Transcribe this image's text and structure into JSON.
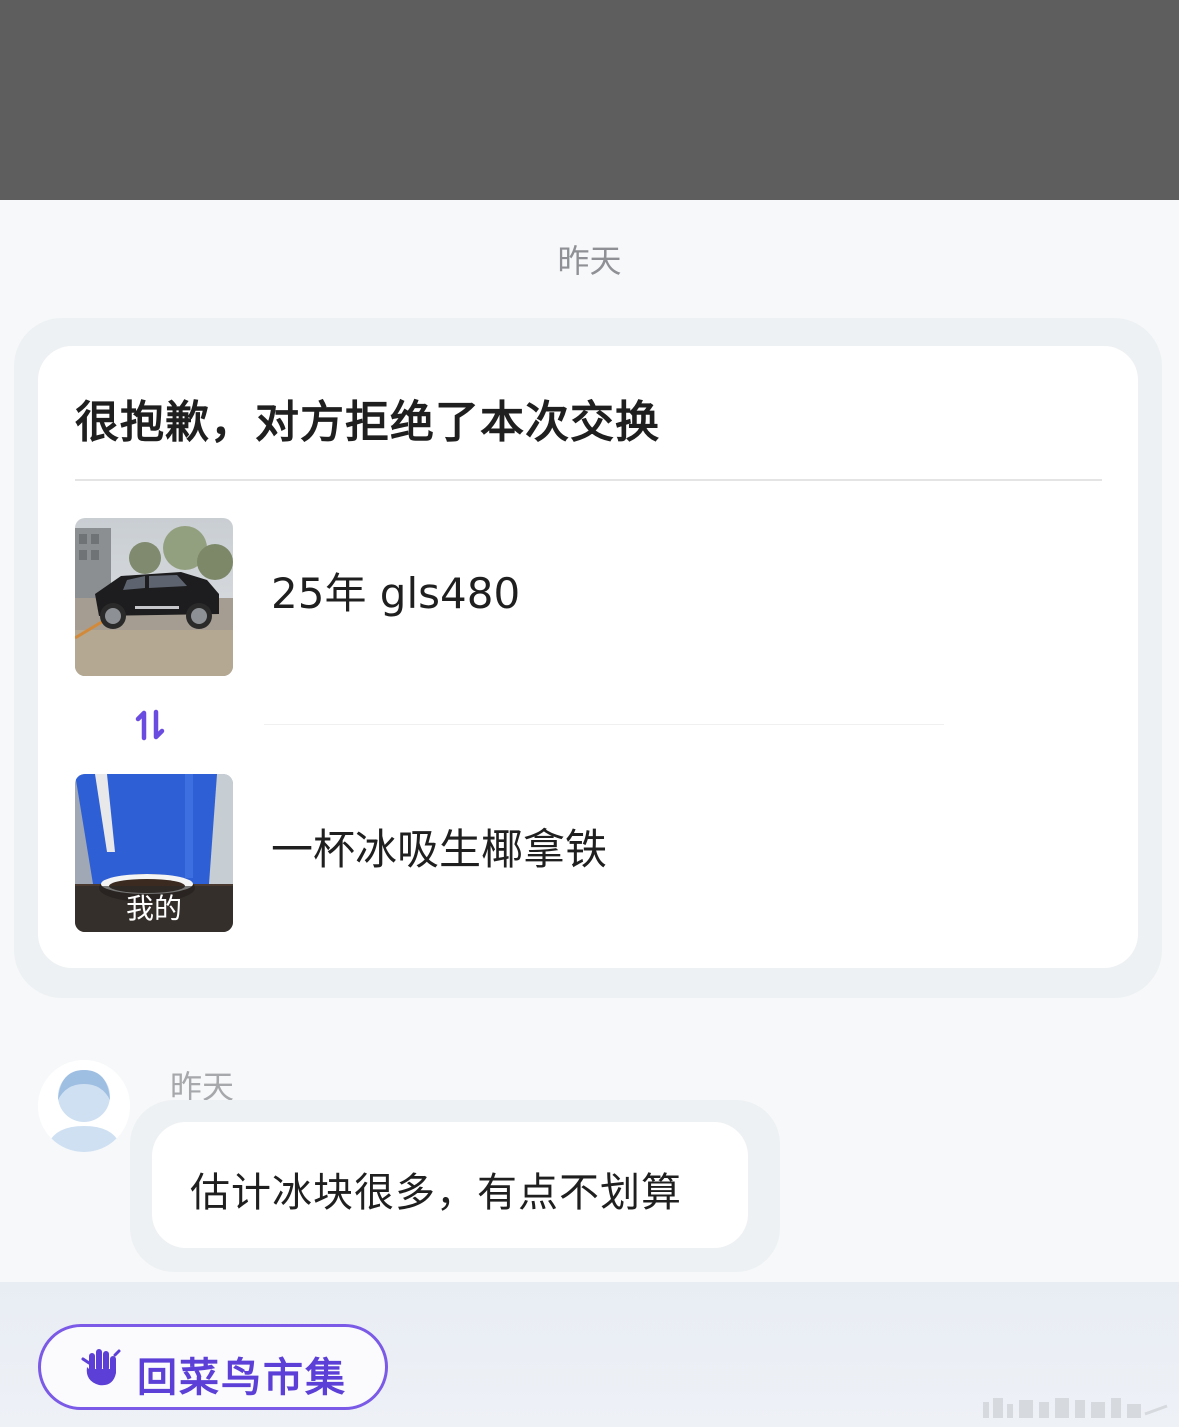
{
  "header": {
    "time_label": "昨天"
  },
  "exchange_card": {
    "title": "很抱歉，对方拒绝了本次交换",
    "their_item": {
      "label": "25年 gls480",
      "image": "car-photo"
    },
    "swap_icon": "swap-arrows-icon",
    "my_item": {
      "label": "一杯冰吸生椰拿铁",
      "image": "coffee-cup-photo",
      "tag": "我的"
    }
  },
  "chat": {
    "message": {
      "time": "昨天",
      "text": "估计冰块很多，有点不划算",
      "avatar": "default-avatar"
    }
  },
  "bottom": {
    "back_button_label": "回菜鸟市集",
    "back_button_icon": "hand-icon"
  },
  "colors": {
    "accent": "#6b4ce0",
    "overlay": "#5e5e5e",
    "background": "#f6f8f9"
  }
}
